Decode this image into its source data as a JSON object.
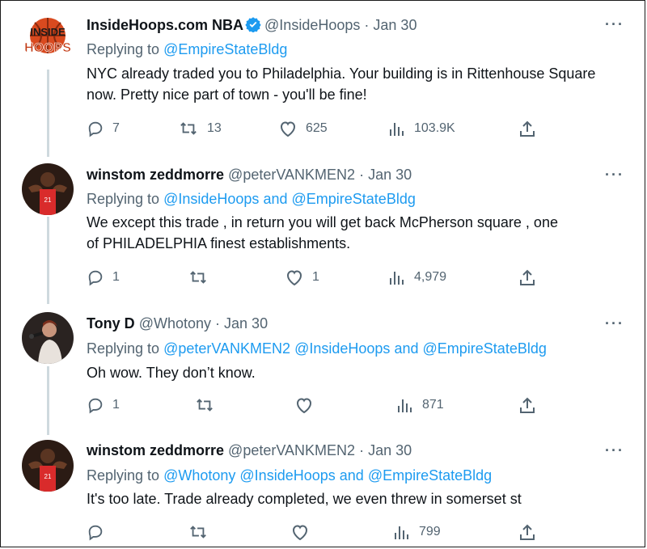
{
  "thread": [
    {
      "author": "InsideHoops.com NBA",
      "handle": "@InsideHoops",
      "date": "Jan 30",
      "verified": true,
      "avatar_icon": "insidehoops-logo",
      "logo_text_top": "INSIDE",
      "logo_text_bottom": "HOOPS",
      "replying_label": "Replying to",
      "replying_to": [
        "@EmpireStateBldg"
      ],
      "text": "NYC already traded you to Philadelphia. Your building is in Rittenhouse Square now. Pretty nice part of town - you'll be fine!",
      "replies": "7",
      "retweets": "13",
      "likes": "625",
      "views": "103.9K"
    },
    {
      "author": "winstom zeddmorre",
      "handle": "@peterVANKMEN2",
      "date": "Jan 30",
      "avatar_icon": "basketball-player-avatar",
      "replying_label": "Replying to",
      "replying_to": [
        "@InsideHoops",
        "and",
        "@EmpireStateBldg"
      ],
      "text_line1": "We except this trade , in return you will get back McPherson square , one",
      "text_line2": "of PHILADELPHIA finest establishments.",
      "replies": "1",
      "retweets": "",
      "likes": "1",
      "views": "4,979"
    },
    {
      "author": "Tony D",
      "handle": "@Whotony",
      "date": "Jan 30",
      "avatar_icon": "singer-avatar",
      "replying_label": "Replying to",
      "replying_to": [
        "@peterVANKMEN2",
        "@InsideHoops",
        "and",
        "@EmpireStateBldg"
      ],
      "text": "Oh wow. They don’t know.",
      "replies": "1",
      "retweets": "",
      "likes": "",
      "views": "871"
    },
    {
      "author": "winstom zeddmorre",
      "handle": "@peterVANKMEN2",
      "date": "Jan 30",
      "avatar_icon": "basketball-player-avatar",
      "replying_label": "Replying to",
      "replying_to": [
        "@Whotony",
        "@InsideHoops",
        "and",
        "@EmpireStateBldg"
      ],
      "text": "It's too late. Trade already completed, we even threw in somerset st",
      "replies": "",
      "retweets": "",
      "likes": "",
      "views": "799"
    }
  ],
  "colors": {
    "accent": "#1d9bf0",
    "secondary_text": "#536471",
    "thread_line": "#cfd9de"
  },
  "separator": "·",
  "more_label": "···"
}
